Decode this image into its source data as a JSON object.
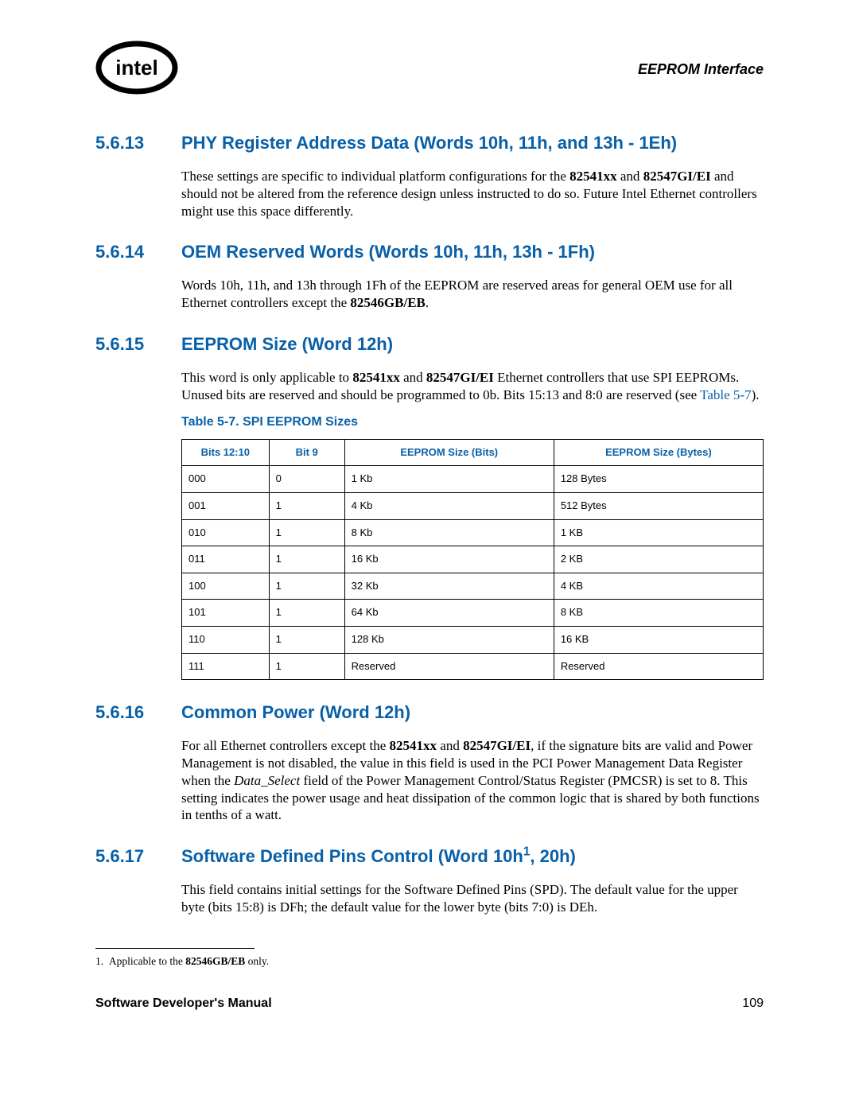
{
  "header": {
    "title": "EEPROM Interface"
  },
  "sections": {
    "s1": {
      "num": "5.6.13",
      "title": "PHY Register Address Data (Words 10h, 11h, and 13h - 1Eh)",
      "p1a": "These settings are specific to individual platform configurations for the ",
      "p1b": "82541xx",
      "p1c": " and ",
      "p1d": "82547GI/EI",
      "p1e": " and should not be altered from the reference design unless instructed to do so. Future Intel Ethernet controllers might use this space differently."
    },
    "s2": {
      "num": "5.6.14",
      "title": "OEM Reserved Words (Words 10h, 11h, 13h - 1Fh)",
      "p1a": "Words 10h, 11h, and 13h through 1Fh of the EEPROM are reserved areas for general OEM use for all Ethernet controllers except the ",
      "p1b": "82546GB/EB",
      "p1c": "."
    },
    "s3": {
      "num": "5.6.15",
      "title": "EEPROM Size (Word 12h)",
      "p1a": "This word is only applicable to ",
      "p1b": "82541xx",
      "p1c": " and ",
      "p1d": "82547GI/EI",
      "p1e": " Ethernet controllers that use SPI EEPROMs. Unused bits are reserved and should be programmed to 0b. Bits 15:13 and 8:0 are reserved (see ",
      "p1f": "Table 5-7",
      "p1g": ")."
    },
    "s4": {
      "num": "5.6.16",
      "title": "Common Power (Word 12h)",
      "p1a": "For all Ethernet controllers except the ",
      "p1b": "82541xx",
      "p1c": " and ",
      "p1d": "82547GI/EI",
      "p1e": ", if the signature bits are valid and Power Management is not disabled, the value in this field is used in the PCI Power Management Data Register when the ",
      "p1f": "Data_Select",
      "p1g": " field of the Power Management Control/Status Register (PMCSR) is set to 8. This setting indicates the power usage and heat dissipation of the common logic that is shared by both functions in tenths of a watt."
    },
    "s5": {
      "num": "5.6.17",
      "title_a": "Software Defined Pins Control (Word 10h",
      "title_sup": "1",
      "title_b": ", 20h)",
      "p1": "This field contains initial settings for the Software Defined Pins (SPD). The default value for the upper byte (bits 15:8) is DFh; the default value for the lower byte (bits 7:0) is DEh."
    }
  },
  "table": {
    "caption": "Table 5-7. SPI EEPROM Sizes",
    "headers": [
      "Bits 12:10",
      "Bit 9",
      "EEPROM Size (Bits)",
      "EEPROM Size (Bytes)"
    ],
    "rows": [
      [
        "000",
        "0",
        "1 Kb",
        "128 Bytes"
      ],
      [
        "001",
        "1",
        "4 Kb",
        "512 Bytes"
      ],
      [
        "010",
        "1",
        "8 Kb",
        "1 KB"
      ],
      [
        "011",
        "1",
        "16 Kb",
        "2 KB"
      ],
      [
        "100",
        "1",
        "32 Kb",
        "4 KB"
      ],
      [
        "101",
        "1",
        "64 Kb",
        "8 KB"
      ],
      [
        "110",
        "1",
        "128 Kb",
        "16 KB"
      ],
      [
        "111",
        "1",
        "Reserved",
        "Reserved"
      ]
    ]
  },
  "footnote": {
    "n": "1.",
    "ta": "Applicable to the ",
    "tb": "82546GB/EB",
    "tc": " only."
  },
  "footer": {
    "left": "Software Developer's Manual",
    "right": "109"
  }
}
